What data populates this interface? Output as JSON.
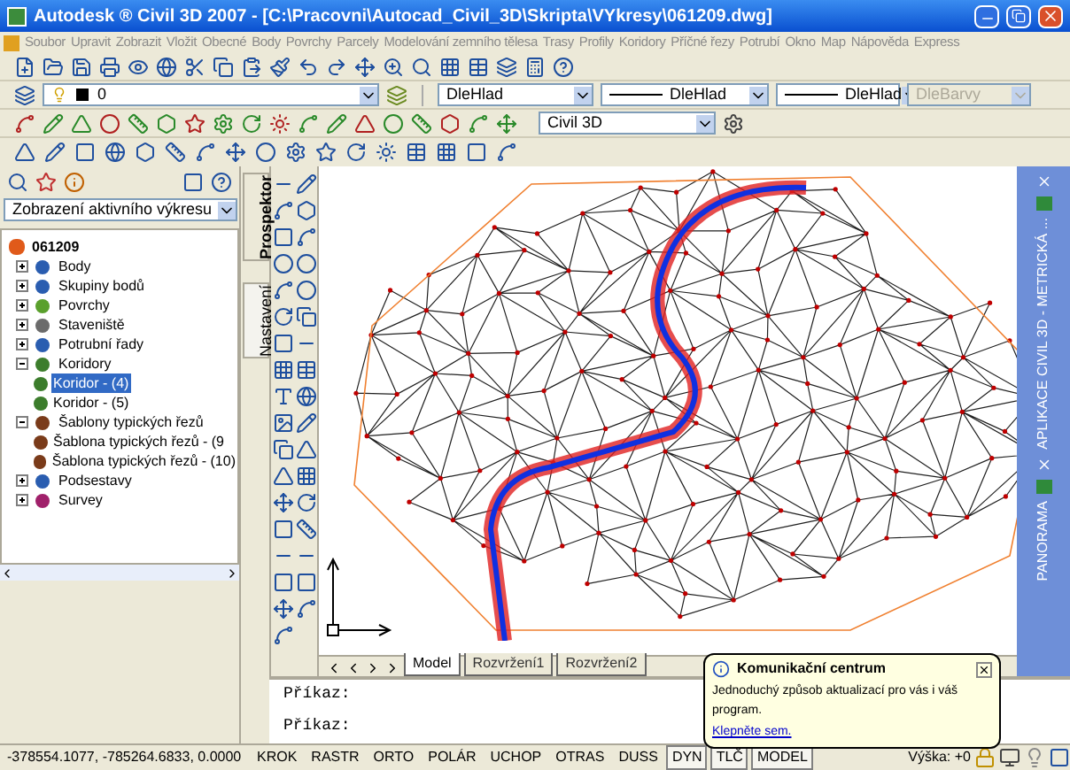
{
  "window": {
    "title": "Autodesk ® Civil 3D 2007 - [C:\\Pracovni\\Autocad_Civil_3D\\Skripta\\VYkresy\\061209.dwg]"
  },
  "menu": [
    "Soubor",
    "Upravit",
    "Zobrazit",
    "Vložit",
    "Obecné",
    "Body",
    "Povrchy",
    "Parcely",
    "Modelování zemního tělesa",
    "Trasy",
    "Profily",
    "Koridory",
    "Příčné řezy",
    "Potrubí",
    "Okno",
    "Map",
    "Nápověda",
    "Express"
  ],
  "layer_combo": {
    "value": "0"
  },
  "color_combo": {
    "value": "DleHlad"
  },
  "linetype_combo": {
    "value": "DleHlad"
  },
  "lineweight_combo": {
    "value": "DleHlad"
  },
  "plotstyle_combo": {
    "value": "DleBarvy",
    "disabled": true
  },
  "workspace_combo": {
    "value": "Civil 3D"
  },
  "toolspace": {
    "view_combo": {
      "value": "Zobrazení aktivního výkresu"
    },
    "tree": {
      "label": "061209",
      "children": [
        {
          "label": "Body",
          "expanded": false,
          "selected": false
        },
        {
          "label": "Skupiny bodů",
          "expanded": false,
          "selected": false
        },
        {
          "label": "Povrchy",
          "expanded": false,
          "selected": false
        },
        {
          "label": "Staveniště",
          "expanded": false,
          "selected": false
        },
        {
          "label": "Potrubní řady",
          "expanded": false,
          "selected": false
        },
        {
          "label": "Koridory",
          "expanded": true,
          "selected": false,
          "children": [
            {
              "label": "Koridor - (4)",
              "selected": true
            },
            {
              "label": "Koridor - (5)",
              "selected": false
            }
          ]
        },
        {
          "label": "Šablony typických řezů",
          "expanded": true,
          "selected": false,
          "children": [
            {
              "label": "Šablona typických řezů - (9",
              "selected": false
            },
            {
              "label": "Šablona typických řezů - (10)",
              "selected": false
            }
          ]
        },
        {
          "label": "Podsestavy",
          "expanded": false,
          "selected": false
        },
        {
          "label": "Survey",
          "expanded": false,
          "selected": false
        }
      ]
    },
    "tabs": [
      {
        "label": "Prospektor",
        "selected": true
      },
      {
        "label": "Nastavení",
        "selected": false
      }
    ]
  },
  "layout_tabs": [
    {
      "label": "Model",
      "selected": true
    },
    {
      "label": "Rozvržení1",
      "selected": false
    },
    {
      "label": "Rozvržení2",
      "selected": false
    }
  ],
  "command_lines": [
    "Příkaz:",
    "Příkaz:"
  ],
  "side_palettes": [
    {
      "label": "APLIKACE CIVIL 3D - METRICKÁ ..."
    },
    {
      "label": "PANORAMA"
    }
  ],
  "notification": {
    "title": "Komunikační centrum",
    "message": "Jednoduchý způsob aktualizací pro vás i váš program.",
    "link": "Klepněte sem."
  },
  "status_bar": {
    "coordinates": "-378554.1077, -785264.6833, 0.0000",
    "toggles": [
      {
        "label": "KROK",
        "on": false
      },
      {
        "label": "RASTR",
        "on": false
      },
      {
        "label": "ORTO",
        "on": false
      },
      {
        "label": "POLÁR",
        "on": false
      },
      {
        "label": "UCHOP",
        "on": false
      },
      {
        "label": "OTRAS",
        "on": false
      },
      {
        "label": "DUSS",
        "on": false
      },
      {
        "label": "DYN",
        "on": true
      },
      {
        "label": "TLČ",
        "on": true
      },
      {
        "label": "MODEL",
        "on": true
      }
    ],
    "elevation": "Výška: +0"
  }
}
